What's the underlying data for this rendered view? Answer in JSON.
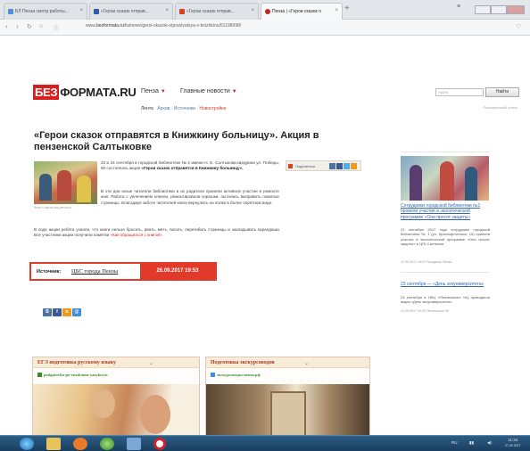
{
  "browser": {
    "tabs": [
      {
        "label": "БЛ Пенза смотр работы...",
        "color": "#4a90d9",
        "active": false
      },
      {
        "label": "«Герои сказок отправ...",
        "color": "#2a5caa",
        "active": false
      },
      {
        "label": "«Герои сказок отправ...",
        "color": "#d8401e",
        "active": false
      },
      {
        "label": "Пенза | «Герои сказок о",
        "color": "#c2261e",
        "active": true
      }
    ],
    "new_tab": "+",
    "url_prefix": "www.",
    "url_domain": "bezformata.ru",
    "url_path": "/listnews/geroi-skazok-otpravlyatsya-v-knizhkinu/61198998/"
  },
  "site": {
    "logo_red": "БЕЗ",
    "logo_rest": "ФОРМАТА.RU",
    "city": "Пенза",
    "main_news": "Главные новости",
    "subnav": [
      "Лента",
      "Архив",
      "Источники",
      "Новостройки"
    ],
    "search_placeholder": "Найти",
    "search_button": "Найти",
    "advanced_search": "Расширенный поиск"
  },
  "article": {
    "title": "«Герои сказок отправятся в Книжкину больницу». Акция в пензенской Салтыковке",
    "photo_caption": "Фото с сайта cbs-penza.ru",
    "p1_normal": "23 и 24 сентября в городской библиотеке № 2 имени Н. Е. Салтыкова-Щедрина ул. Победы, 60 состоялась акция ",
    "p1_bold": "«Герои сказок отправятся в Книжкину больницу».",
    "p2": "В эти дни юные читатели библиотеки и их родители приняли активное участие в ремонте книг. Работа с увлечением клеили, ремонтировали корешки, пытались выправить помятые страницы. Благодаря заботе читателей книги вернулись на полки в более опрятном виде.",
    "p3_normal": "В ходе акции ребята узнали, что книги нельзя бросать, рвать, мять, писать, перегибать страницы и закладывать карандаши. Все участники акции получили памятки ",
    "p3_red": "«Как обращаться с книгой».",
    "share_label": "Поделиться"
  },
  "source": {
    "label": "Источник:",
    "value": "ЦБС города Пензы",
    "date": "26.09.2017 19:53"
  },
  "sidebar": {
    "item1_link": "Сотрудники городской библиотеки №1 провели участие в экологической программе «Они просят защиты»",
    "item1_text": "21 сентября 2017 года сотрудники городской библиотеки № 1 (ул. Краснофлотская, 15) приняли участие в экологической программе «Они просят защиты» в ЦГБ Салтыков",
    "item1_date": "22.09.2017 18:51 Городская Пенза",
    "item2_link": "23 сентября — «День экоуниверситета»",
    "item2_text": "23 сентября в НКЦ «Пензенское» НЦ проводится акция «День экоуниверситета»",
    "item2_date": "22.09.2017 09:03 Пензенская ЛК"
  },
  "widgets": [
    {
      "title": "ЕГЭ подготовка русскому языку",
      "sub": "podgotovka-po-russkomu-yazyku.ru"
    },
    {
      "title": "Подготовка экскурсоводов",
      "sub": "экскурсоводы-пенза.рф"
    }
  ],
  "taskbar": {
    "lang": "RU",
    "time": "11:34",
    "date": "27.09.2017"
  },
  "colors": {
    "brand_red": "#d81e1e",
    "source_red": "#e23a2a",
    "link_blue": "#3466a8"
  }
}
